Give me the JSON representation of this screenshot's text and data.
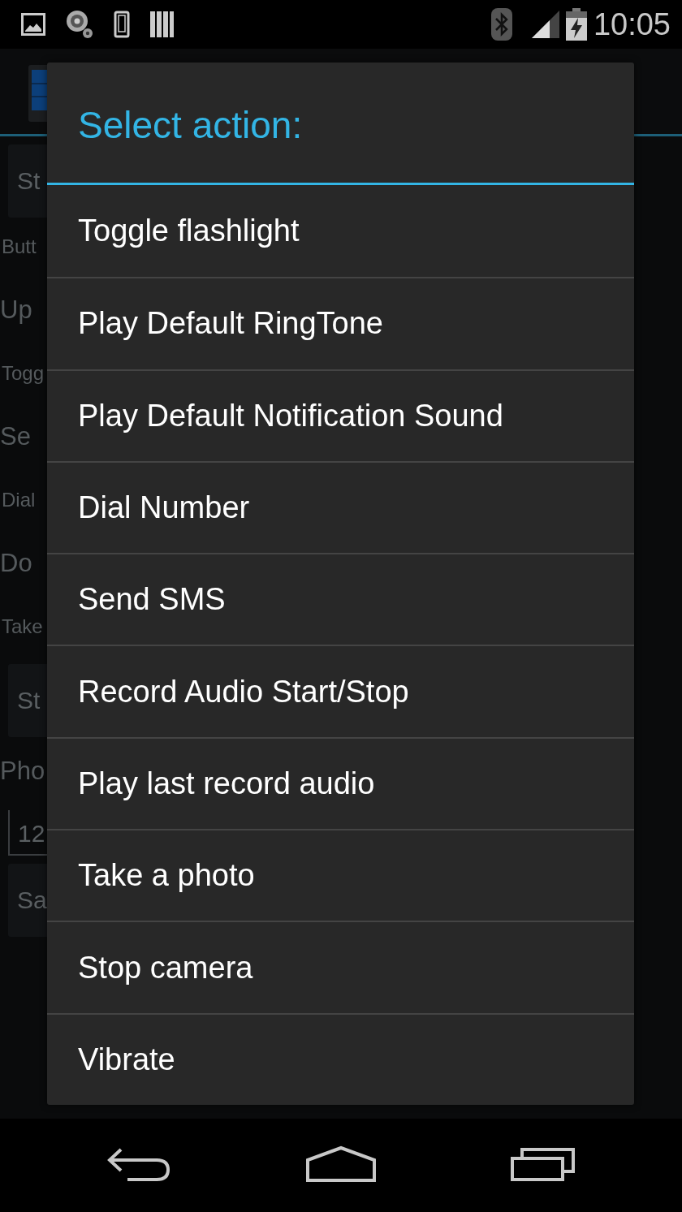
{
  "status_bar": {
    "time": "10:05"
  },
  "background": {
    "items": [
      {
        "kind": "button",
        "text": "St"
      },
      {
        "kind": "caption",
        "text": "Butt"
      },
      {
        "kind": "heading",
        "text": "Up"
      },
      {
        "kind": "caption",
        "text": "Togg"
      },
      {
        "kind": "heading",
        "text": "Se"
      },
      {
        "kind": "caption",
        "text": "Dial"
      },
      {
        "kind": "heading",
        "text": "Do"
      },
      {
        "kind": "caption",
        "text": "Take"
      },
      {
        "kind": "button",
        "text": "St"
      },
      {
        "kind": "heading",
        "text": "Pho"
      },
      {
        "kind": "field",
        "text": "12"
      },
      {
        "kind": "button",
        "text": "Sa"
      }
    ]
  },
  "dialog": {
    "title": "Select action:",
    "items": [
      {
        "label": "Toggle flashlight"
      },
      {
        "label": "Play Default RingTone"
      },
      {
        "label": "Play Default Notification Sound"
      },
      {
        "label": "Dial Number"
      },
      {
        "label": "Send SMS"
      },
      {
        "label": "Record Audio Start/Stop"
      },
      {
        "label": "Play last record audio"
      },
      {
        "label": "Take a photo"
      },
      {
        "label": "Stop camera"
      },
      {
        "label": "Vibrate"
      }
    ]
  }
}
